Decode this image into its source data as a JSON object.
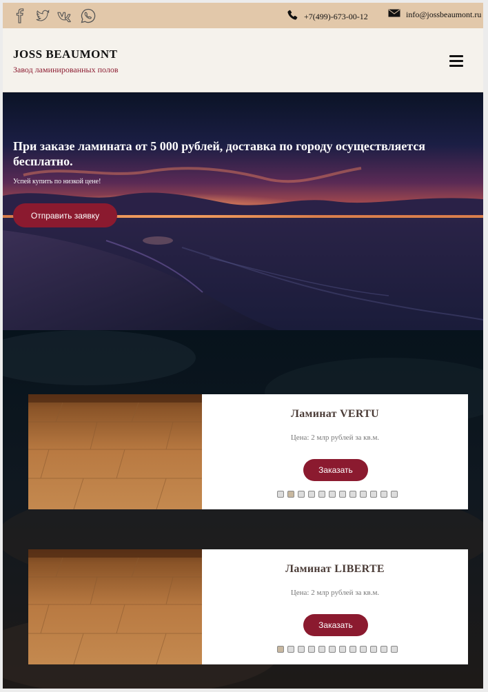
{
  "topbar": {
    "social": [
      "facebook-icon",
      "twitter-icon",
      "vk-icon",
      "whatsapp-icon"
    ],
    "phone": "+7(499)-673-00-12",
    "email": "info@jossbeaumont.ru"
  },
  "header": {
    "brand": "JOSS BEAUMONT",
    "tagline": "Завод ламинированных полов",
    "menu_icon": "hamburger-menu-icon"
  },
  "hero": {
    "headline": "При заказе ламината от 5 000 рублей, доставка по городу осуществляется бесплатно.",
    "subtext": "Успей купить по низкой цене!",
    "button": "Отправить заявку"
  },
  "products": [
    {
      "title": "Ламинат VERTU",
      "price": "Цена: 2 млр рублей за кв.м.",
      "button": "Заказать",
      "slides": 12,
      "active_slide": 1
    },
    {
      "title": "Ламинат LIBERTE",
      "price": "Цена: 2 млр рублей за кв.м.",
      "button": "Заказать",
      "slides": 12,
      "active_slide": 0
    }
  ],
  "colors": {
    "topbar_bg": "#e2c8aa",
    "header_bg": "#f5f2ec",
    "accent": "#8b1a2f"
  }
}
